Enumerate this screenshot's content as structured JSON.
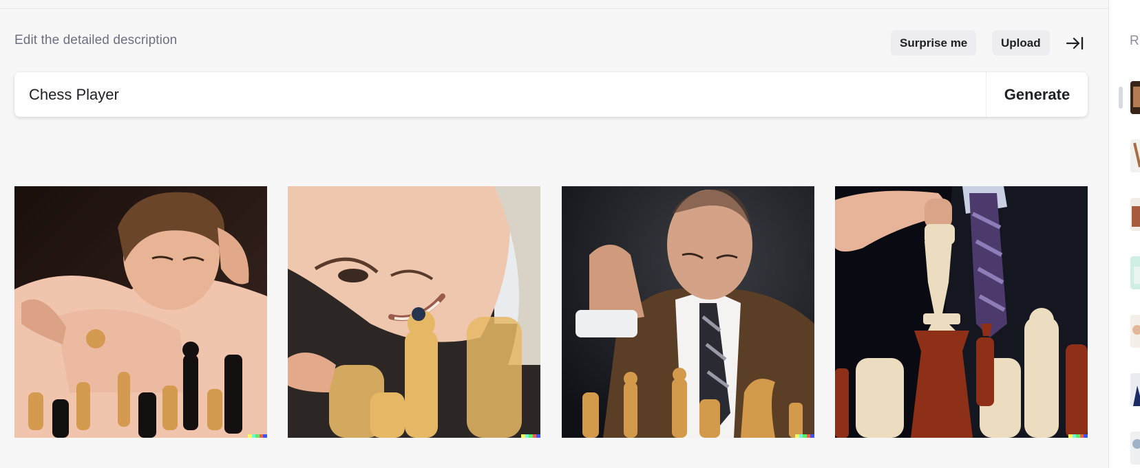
{
  "header": {
    "title": "Edit the detailed description",
    "surprise_label": "Surprise me",
    "upload_label": "Upload",
    "collapse_icon": "collapse-right-icon"
  },
  "prompt": {
    "value": "Chess Player",
    "generate_label": "Generate"
  },
  "results": [
    {
      "name": "young man in pink shirt playing chess"
    },
    {
      "name": "smiling young man close to chess pieces"
    },
    {
      "name": "bald man in brown suit thinking over chess board"
    },
    {
      "name": "hand moving a white king above the board"
    }
  ],
  "sidebar": {
    "heading": "R",
    "thumb_count": 7
  },
  "colors": {
    "background": "#f7f7f8",
    "button_bg": "#ececf1",
    "heading_text": "#6e6e80",
    "text": "#202123"
  }
}
